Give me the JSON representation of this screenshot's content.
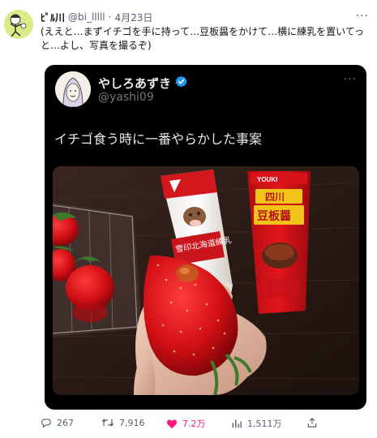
{
  "tweet": {
    "display_name": "ﾋﾟﾙ川",
    "handle": "@bi_lllll",
    "separator": "·",
    "date": "4月23日",
    "more": "···",
    "text": "(ええと…まずイチゴを手に持って…豆板醤をかけて…横に練乳を置いてっと…よし、写真を撮るぞ)"
  },
  "quote": {
    "display_name": "やしろあずき",
    "handle": "@yashi09",
    "more": "···",
    "text": "イチゴ食う時に一番やらかした事案",
    "photo": {
      "condensed_milk_label": "雪印北海道練乳",
      "doubanjiang_brand": "YOUKI",
      "doubanjiang_label_1": "四川",
      "doubanjiang_label_2": "豆板醤"
    }
  },
  "actions": {
    "replies": "267",
    "retweets": "7,916",
    "likes": "7.2万",
    "views": "1,511万"
  },
  "colors": {
    "like": "#f91880",
    "verified": "#1d9bf0",
    "muted": "#536471"
  }
}
